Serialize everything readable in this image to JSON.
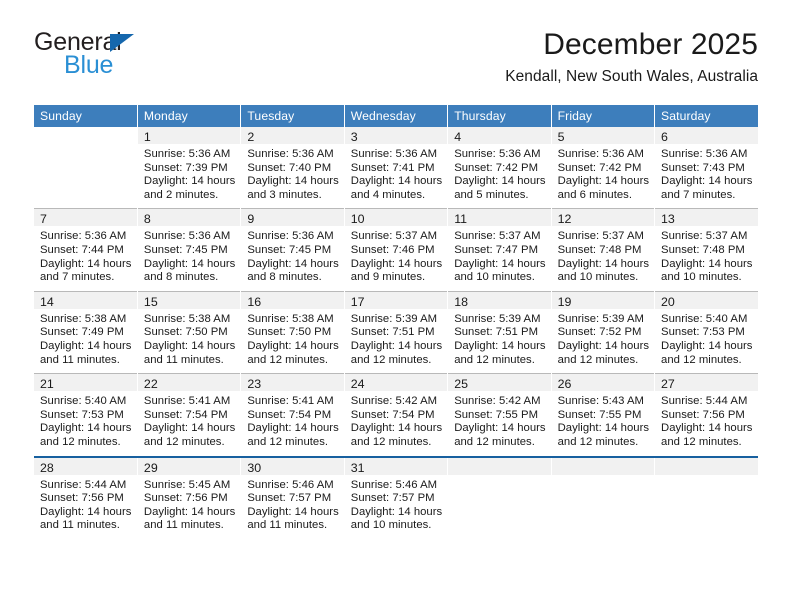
{
  "brand": {
    "name_part1": "General",
    "name_part2": "Blue"
  },
  "header": {
    "title": "December 2025",
    "subtitle": "Kendall, New South Wales, Australia"
  },
  "weekday_headers": [
    "Sunday",
    "Monday",
    "Tuesday",
    "Wednesday",
    "Thursday",
    "Friday",
    "Saturday"
  ],
  "colors": {
    "header_blue": "#3d7ebc",
    "brand_blue": "#2a8fd4",
    "brand_triangle": "#1567ad",
    "daynum_band": "#f1f1f1",
    "row_divider": "#b9b9b9",
    "last_row_divider": "#17609f",
    "text": "#1a1a1a"
  },
  "weeks": [
    [
      {
        "day": "",
        "sunrise": "",
        "sunset": "",
        "daylight_line1": "",
        "daylight_line2": "",
        "blank": true
      },
      {
        "day": "1",
        "sunrise": "Sunrise: 5:36 AM",
        "sunset": "Sunset: 7:39 PM",
        "daylight_line1": "Daylight: 14 hours",
        "daylight_line2": "and 2 minutes."
      },
      {
        "day": "2",
        "sunrise": "Sunrise: 5:36 AM",
        "sunset": "Sunset: 7:40 PM",
        "daylight_line1": "Daylight: 14 hours",
        "daylight_line2": "and 3 minutes."
      },
      {
        "day": "3",
        "sunrise": "Sunrise: 5:36 AM",
        "sunset": "Sunset: 7:41 PM",
        "daylight_line1": "Daylight: 14 hours",
        "daylight_line2": "and 4 minutes."
      },
      {
        "day": "4",
        "sunrise": "Sunrise: 5:36 AM",
        "sunset": "Sunset: 7:42 PM",
        "daylight_line1": "Daylight: 14 hours",
        "daylight_line2": "and 5 minutes."
      },
      {
        "day": "5",
        "sunrise": "Sunrise: 5:36 AM",
        "sunset": "Sunset: 7:42 PM",
        "daylight_line1": "Daylight: 14 hours",
        "daylight_line2": "and 6 minutes."
      },
      {
        "day": "6",
        "sunrise": "Sunrise: 5:36 AM",
        "sunset": "Sunset: 7:43 PM",
        "daylight_line1": "Daylight: 14 hours",
        "daylight_line2": "and 7 minutes."
      }
    ],
    [
      {
        "day": "7",
        "sunrise": "Sunrise: 5:36 AM",
        "sunset": "Sunset: 7:44 PM",
        "daylight_line1": "Daylight: 14 hours",
        "daylight_line2": "and 7 minutes."
      },
      {
        "day": "8",
        "sunrise": "Sunrise: 5:36 AM",
        "sunset": "Sunset: 7:45 PM",
        "daylight_line1": "Daylight: 14 hours",
        "daylight_line2": "and 8 minutes."
      },
      {
        "day": "9",
        "sunrise": "Sunrise: 5:36 AM",
        "sunset": "Sunset: 7:45 PM",
        "daylight_line1": "Daylight: 14 hours",
        "daylight_line2": "and 8 minutes."
      },
      {
        "day": "10",
        "sunrise": "Sunrise: 5:37 AM",
        "sunset": "Sunset: 7:46 PM",
        "daylight_line1": "Daylight: 14 hours",
        "daylight_line2": "and 9 minutes."
      },
      {
        "day": "11",
        "sunrise": "Sunrise: 5:37 AM",
        "sunset": "Sunset: 7:47 PM",
        "daylight_line1": "Daylight: 14 hours",
        "daylight_line2": "and 10 minutes."
      },
      {
        "day": "12",
        "sunrise": "Sunrise: 5:37 AM",
        "sunset": "Sunset: 7:48 PM",
        "daylight_line1": "Daylight: 14 hours",
        "daylight_line2": "and 10 minutes."
      },
      {
        "day": "13",
        "sunrise": "Sunrise: 5:37 AM",
        "sunset": "Sunset: 7:48 PM",
        "daylight_line1": "Daylight: 14 hours",
        "daylight_line2": "and 10 minutes."
      }
    ],
    [
      {
        "day": "14",
        "sunrise": "Sunrise: 5:38 AM",
        "sunset": "Sunset: 7:49 PM",
        "daylight_line1": "Daylight: 14 hours",
        "daylight_line2": "and 11 minutes."
      },
      {
        "day": "15",
        "sunrise": "Sunrise: 5:38 AM",
        "sunset": "Sunset: 7:50 PM",
        "daylight_line1": "Daylight: 14 hours",
        "daylight_line2": "and 11 minutes."
      },
      {
        "day": "16",
        "sunrise": "Sunrise: 5:38 AM",
        "sunset": "Sunset: 7:50 PM",
        "daylight_line1": "Daylight: 14 hours",
        "daylight_line2": "and 12 minutes."
      },
      {
        "day": "17",
        "sunrise": "Sunrise: 5:39 AM",
        "sunset": "Sunset: 7:51 PM",
        "daylight_line1": "Daylight: 14 hours",
        "daylight_line2": "and 12 minutes."
      },
      {
        "day": "18",
        "sunrise": "Sunrise: 5:39 AM",
        "sunset": "Sunset: 7:51 PM",
        "daylight_line1": "Daylight: 14 hours",
        "daylight_line2": "and 12 minutes."
      },
      {
        "day": "19",
        "sunrise": "Sunrise: 5:39 AM",
        "sunset": "Sunset: 7:52 PM",
        "daylight_line1": "Daylight: 14 hours",
        "daylight_line2": "and 12 minutes."
      },
      {
        "day": "20",
        "sunrise": "Sunrise: 5:40 AM",
        "sunset": "Sunset: 7:53 PM",
        "daylight_line1": "Daylight: 14 hours",
        "daylight_line2": "and 12 minutes."
      }
    ],
    [
      {
        "day": "21",
        "sunrise": "Sunrise: 5:40 AM",
        "sunset": "Sunset: 7:53 PM",
        "daylight_line1": "Daylight: 14 hours",
        "daylight_line2": "and 12 minutes."
      },
      {
        "day": "22",
        "sunrise": "Sunrise: 5:41 AM",
        "sunset": "Sunset: 7:54 PM",
        "daylight_line1": "Daylight: 14 hours",
        "daylight_line2": "and 12 minutes."
      },
      {
        "day": "23",
        "sunrise": "Sunrise: 5:41 AM",
        "sunset": "Sunset: 7:54 PM",
        "daylight_line1": "Daylight: 14 hours",
        "daylight_line2": "and 12 minutes."
      },
      {
        "day": "24",
        "sunrise": "Sunrise: 5:42 AM",
        "sunset": "Sunset: 7:54 PM",
        "daylight_line1": "Daylight: 14 hours",
        "daylight_line2": "and 12 minutes."
      },
      {
        "day": "25",
        "sunrise": "Sunrise: 5:42 AM",
        "sunset": "Sunset: 7:55 PM",
        "daylight_line1": "Daylight: 14 hours",
        "daylight_line2": "and 12 minutes."
      },
      {
        "day": "26",
        "sunrise": "Sunrise: 5:43 AM",
        "sunset": "Sunset: 7:55 PM",
        "daylight_line1": "Daylight: 14 hours",
        "daylight_line2": "and 12 minutes."
      },
      {
        "day": "27",
        "sunrise": "Sunrise: 5:44 AM",
        "sunset": "Sunset: 7:56 PM",
        "daylight_line1": "Daylight: 14 hours",
        "daylight_line2": "and 12 minutes."
      }
    ],
    [
      {
        "day": "28",
        "sunrise": "Sunrise: 5:44 AM",
        "sunset": "Sunset: 7:56 PM",
        "daylight_line1": "Daylight: 14 hours",
        "daylight_line2": "and 11 minutes."
      },
      {
        "day": "29",
        "sunrise": "Sunrise: 5:45 AM",
        "sunset": "Sunset: 7:56 PM",
        "daylight_line1": "Daylight: 14 hours",
        "daylight_line2": "and 11 minutes."
      },
      {
        "day": "30",
        "sunrise": "Sunrise: 5:46 AM",
        "sunset": "Sunset: 7:57 PM",
        "daylight_line1": "Daylight: 14 hours",
        "daylight_line2": "and 11 minutes."
      },
      {
        "day": "31",
        "sunrise": "Sunrise: 5:46 AM",
        "sunset": "Sunset: 7:57 PM",
        "daylight_line1": "Daylight: 14 hours",
        "daylight_line2": "and 10 minutes."
      },
      {
        "day": "",
        "sunrise": "",
        "sunset": "",
        "daylight_line1": "",
        "daylight_line2": "",
        "empty_band": true
      },
      {
        "day": "",
        "sunrise": "",
        "sunset": "",
        "daylight_line1": "",
        "daylight_line2": "",
        "empty_band": true
      },
      {
        "day": "",
        "sunrise": "",
        "sunset": "",
        "daylight_line1": "",
        "daylight_line2": "",
        "empty_band": true
      }
    ]
  ]
}
